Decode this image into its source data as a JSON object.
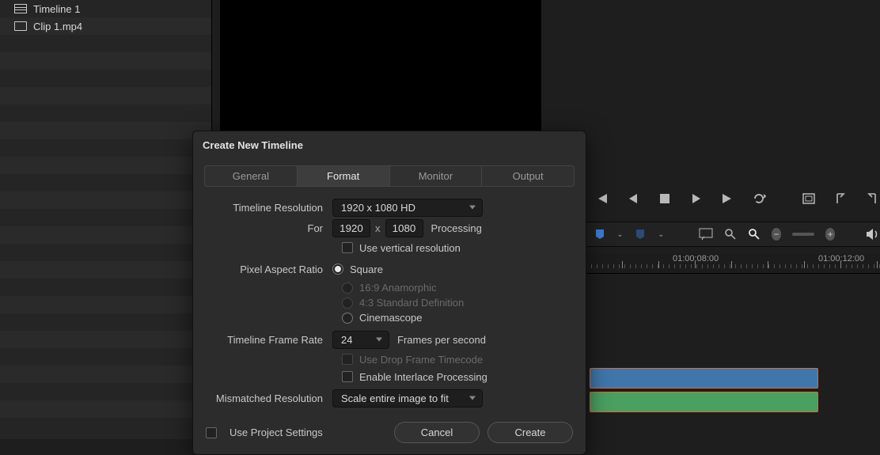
{
  "mediaPool": {
    "items": [
      {
        "label": "Timeline 1",
        "type": "timeline"
      },
      {
        "label": "Clip 1.mp4",
        "type": "clip"
      }
    ]
  },
  "ruler": {
    "labels": [
      "01:00:08:00",
      "01:00:12:00"
    ]
  },
  "dialog": {
    "title": "Create New Timeline",
    "tabs": {
      "general": "General",
      "format": "Format",
      "monitor": "Monitor",
      "output": "Output"
    },
    "labels": {
      "resolution": "Timeline Resolution",
      "for": "For",
      "processing": "Processing",
      "useVertical": "Use vertical resolution",
      "par": "Pixel Aspect Ratio",
      "parSquare": "Square",
      "parAnamorphic": "16:9 Anamorphic",
      "par43": "4:3 Standard Definition",
      "parCinema": "Cinemascope",
      "frameRate": "Timeline Frame Rate",
      "fps": "Frames per second",
      "dropFrame": "Use Drop Frame Timecode",
      "interlace": "Enable Interlace Processing",
      "mismatch": "Mismatched Resolution",
      "useProject": "Use Project Settings",
      "cancel": "Cancel",
      "create": "Create"
    },
    "values": {
      "resolutionPreset": "1920 x 1080 HD",
      "width": "1920",
      "height": "1080",
      "frameRate": "24",
      "mismatch": "Scale entire image to fit"
    }
  }
}
